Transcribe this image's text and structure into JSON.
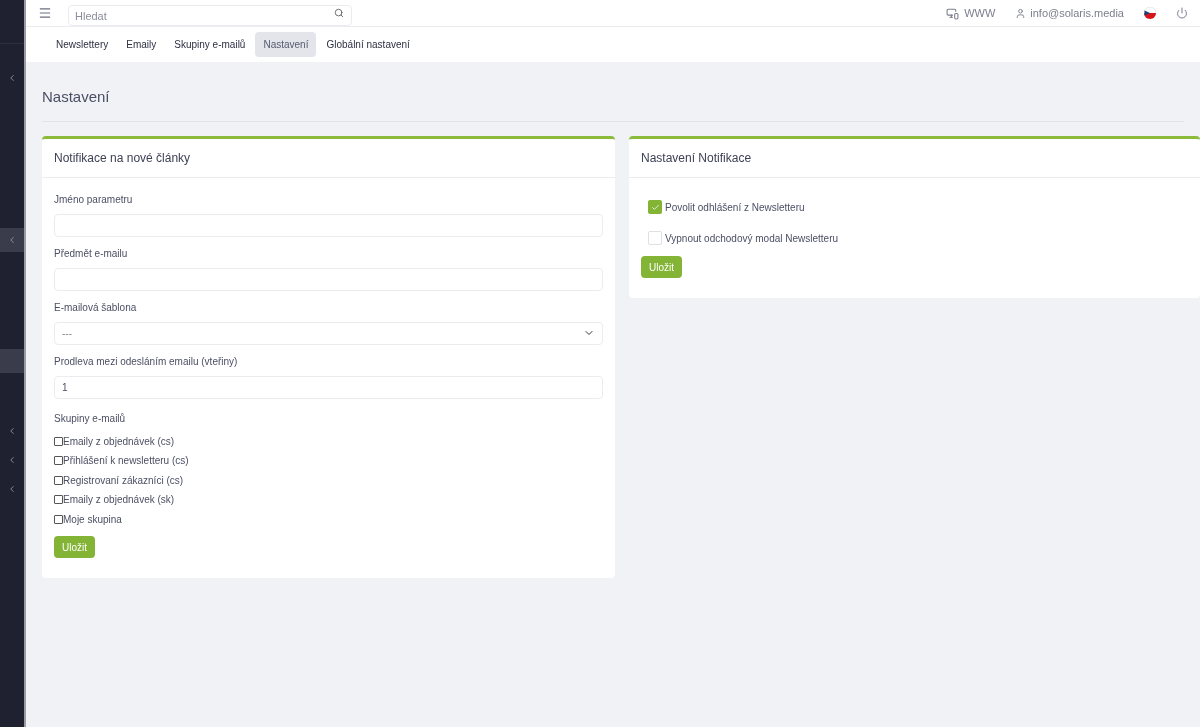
{
  "sidebar": {
    "items": [
      {
        "kind": "chevron",
        "highlighted": false
      },
      {
        "kind": "chevron",
        "highlighted": true
      },
      {
        "kind": "blank",
        "highlighted": true
      },
      {
        "kind": "chevron",
        "highlighted": false
      },
      {
        "kind": "chevron",
        "highlighted": false
      },
      {
        "kind": "chevron",
        "highlighted": false
      }
    ]
  },
  "topbar": {
    "search": {
      "placeholder": "Hledat"
    },
    "www": "WWW",
    "user": "info@solaris.media"
  },
  "tabs": [
    {
      "label": "Newslettery",
      "selected": false
    },
    {
      "label": "Emaily",
      "selected": false
    },
    {
      "label": "Skupiny e-mailů",
      "selected": false
    },
    {
      "label": "Nastavení",
      "selected": true
    },
    {
      "label": "Globální nastavení",
      "selected": false
    }
  ],
  "page_title": "Nastavení",
  "left_card": {
    "title": "Notifikace na nové články",
    "fields": [
      {
        "kind": "text",
        "label": "Jméno parametru"
      },
      {
        "kind": "text",
        "label": "Předmět e-mailu"
      },
      {
        "kind": "select",
        "label": "E-mailová šablona",
        "value": "---"
      },
      {
        "kind": "text",
        "label": "Prodleva mezi odesláním emailu (vteřiny)",
        "value": "1"
      }
    ],
    "groups_label": "Skupiny e-mailů",
    "groups": [
      {
        "label": "Emaily z objednávek (cs)",
        "checked": false
      },
      {
        "label": "Přihlášení k newsletteru (cs)",
        "checked": false
      },
      {
        "label": "Registrovaní zákazníci (cs)",
        "checked": false
      },
      {
        "label": "Emaily z objednávek (sk)",
        "checked": false
      },
      {
        "label": "Moje skupina",
        "checked": false
      }
    ],
    "button": "Uložit"
  },
  "right_card": {
    "title": "Nastavení Notifikace",
    "options": [
      {
        "label": "Povolit odhlášení z Newsletteru",
        "checked": true
      },
      {
        "label": "Vypnout odchodový modal Newsletteru",
        "checked": false
      }
    ],
    "button": "Uložit"
  }
}
